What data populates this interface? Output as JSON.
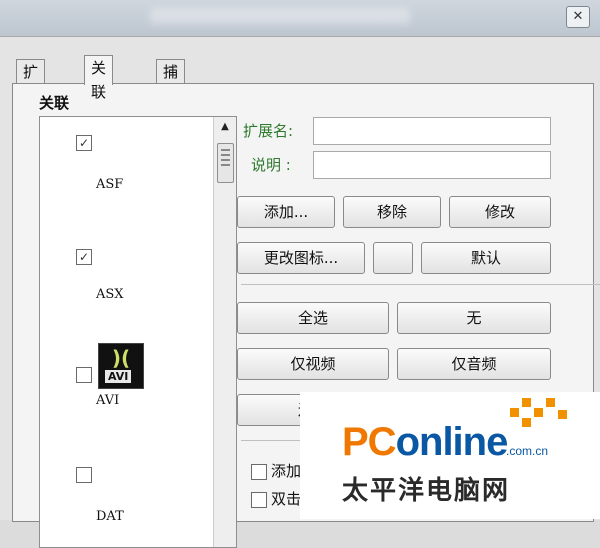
{
  "window": {
    "close_glyph": "✕"
  },
  "tabs": [
    {
      "label": "扩展名",
      "active": false
    },
    {
      "label": "关联",
      "active": true
    },
    {
      "label": "捕获",
      "active": false
    }
  ],
  "group_label": "关联",
  "list_items": [
    {
      "label": "ASF",
      "checked": true
    },
    {
      "label": "ASX",
      "checked": true
    },
    {
      "label": "AVI",
      "checked": false,
      "icon": "avi-file-icon",
      "icon_text": "AVI"
    },
    {
      "label": "DAT",
      "checked": false
    }
  ],
  "check_glyph": "✓",
  "fields": {
    "ext_label": "扩展名:",
    "ext_value": "",
    "desc_label": "说明 :",
    "desc_value": ""
  },
  "buttons": {
    "add": "添加...",
    "remove": "移除",
    "modify": "修改",
    "change_icon": "更改图标...",
    "default": "默认",
    "select_all": "全选",
    "none": "无",
    "video_only": "仅视频",
    "audio_only": "仅音频",
    "restore": "还原"
  },
  "options": {
    "add_label": "添加",
    "dblclick_label": "双击"
  },
  "watermark": {
    "brand_a": "PC",
    "brand_b": "online",
    "domain": ".com.cn",
    "cn_name": "太平洋电脑网"
  },
  "colors": {
    "field_label": "#2e7a2e",
    "brand_blue": "#0a57a4",
    "brand_orange": "#f07800"
  }
}
